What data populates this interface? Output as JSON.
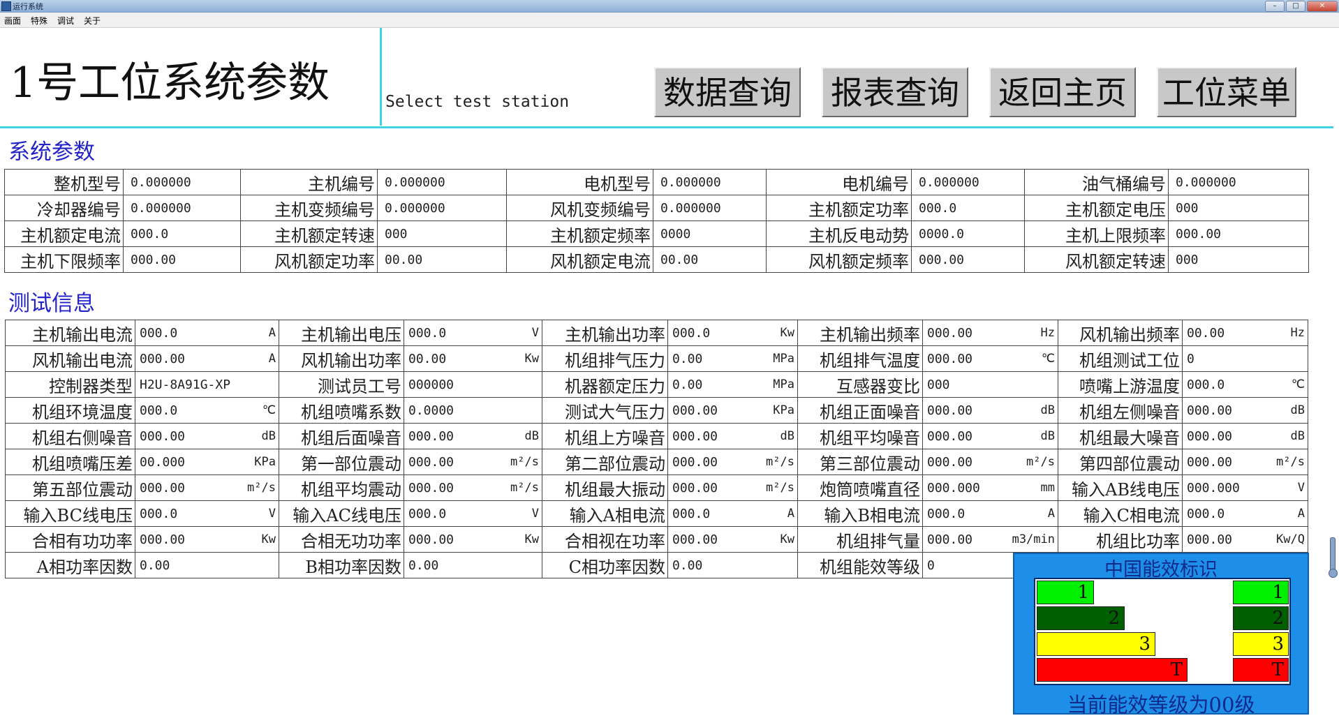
{
  "window": {
    "title": "运行系统",
    "buttons": [
      "–",
      "□",
      "✕"
    ]
  },
  "menu": [
    "画面",
    "特殊",
    "调试",
    "关于"
  ],
  "header": {
    "title": "1号工位系统参数",
    "station_label": "Select test station",
    "buttons": [
      "数据查询",
      "报表查询",
      "返回主页",
      "工位菜单"
    ]
  },
  "system_params": {
    "title": "系统参数",
    "rows": [
      [
        {
          "label": "整机型号",
          "value": "0.000000"
        },
        {
          "label": "主机编号",
          "value": "0.000000"
        },
        {
          "label": "电机型号",
          "value": "0.000000"
        },
        {
          "label": "电机编号",
          "value": "0.000000"
        },
        {
          "label": "油气桶编号",
          "value": "0.000000"
        }
      ],
      [
        {
          "label": "冷却器编号",
          "value": "0.000000"
        },
        {
          "label": "主机变频编号",
          "value": "0.000000"
        },
        {
          "label": "风机变频编号",
          "value": "0.000000"
        },
        {
          "label": "主机额定功率",
          "value": "000.0"
        },
        {
          "label": "主机额定电压",
          "value": "000"
        }
      ],
      [
        {
          "label": "主机额定电流",
          "value": "000.0"
        },
        {
          "label": "主机额定转速",
          "value": "000"
        },
        {
          "label": "主机额定频率",
          "value": "0000"
        },
        {
          "label": "主机反电动势",
          "value": "0000.0"
        },
        {
          "label": "主机上限频率",
          "value": "000.00"
        }
      ],
      [
        {
          "label": "主机下限频率",
          "value": "000.00"
        },
        {
          "label": "风机额定功率",
          "value": "00.00"
        },
        {
          "label": "风机额定电流",
          "value": "00.00"
        },
        {
          "label": "风机额定频率",
          "value": "000.00"
        },
        {
          "label": "风机额定转速",
          "value": "000"
        }
      ]
    ]
  },
  "test_info": {
    "title": "测试信息",
    "rows": [
      [
        {
          "label": "主机输出电流",
          "value": "000.0",
          "unit": "A"
        },
        {
          "label": "主机输出电压",
          "value": "000.0",
          "unit": "V"
        },
        {
          "label": "主机输出功率",
          "value": "000.0",
          "unit": "Kw"
        },
        {
          "label": "主机输出频率",
          "value": "000.00",
          "unit": "Hz"
        },
        {
          "label": "风机输出频率",
          "value": "00.00",
          "unit": "Hz"
        }
      ],
      [
        {
          "label": "风机输出电流",
          "value": "000.00",
          "unit": "A"
        },
        {
          "label": "风机输出功率",
          "value": "00.00",
          "unit": "Kw"
        },
        {
          "label": "机组排气压力",
          "value": "0.00",
          "unit": "MPa"
        },
        {
          "label": "机组排气温度",
          "value": "000.00",
          "unit": "℃"
        },
        {
          "label": "机组测试工位",
          "value": "0",
          "unit": ""
        }
      ],
      [
        {
          "label": "控制器类型",
          "value": "H2U-8A91G-XP",
          "unit": ""
        },
        {
          "label": "测试员工号",
          "value": "000000",
          "unit": ""
        },
        {
          "label": "机器额定压力",
          "value": "0.00",
          "unit": "MPa"
        },
        {
          "label": "互感器变比",
          "value": "000",
          "unit": ""
        },
        {
          "label": "喷嘴上游温度",
          "value": "000.0",
          "unit": "℃"
        }
      ],
      [
        {
          "label": "机组环境温度",
          "value": "000.0",
          "unit": "℃"
        },
        {
          "label": "机组喷嘴系数",
          "value": "0.0000",
          "unit": ""
        },
        {
          "label": "测试大气压力",
          "value": "000.00",
          "unit": "KPa"
        },
        {
          "label": "机组正面噪音",
          "value": "000.00",
          "unit": "dB"
        },
        {
          "label": "机组左侧噪音",
          "value": "000.00",
          "unit": "dB"
        }
      ],
      [
        {
          "label": "机组右侧噪音",
          "value": "000.00",
          "unit": "dB"
        },
        {
          "label": "机组后面噪音",
          "value": "000.00",
          "unit": "dB"
        },
        {
          "label": "机组上方噪音",
          "value": "000.00",
          "unit": "dB"
        },
        {
          "label": "机组平均噪音",
          "value": "000.00",
          "unit": "dB"
        },
        {
          "label": "机组最大噪音",
          "value": "000.00",
          "unit": "dB"
        }
      ],
      [
        {
          "label": "机组喷嘴压差",
          "value": "00.000",
          "unit": "KPa"
        },
        {
          "label": "第一部位震动",
          "value": "000.00",
          "unit": "m²/s"
        },
        {
          "label": "第二部位震动",
          "value": "000.00",
          "unit": "m²/s"
        },
        {
          "label": "第三部位震动",
          "value": "000.00",
          "unit": "m²/s"
        },
        {
          "label": "第四部位震动",
          "value": "000.00",
          "unit": "m²/s"
        }
      ],
      [
        {
          "label": "第五部位震动",
          "value": "000.00",
          "unit": "m²/s"
        },
        {
          "label": "机组平均震动",
          "value": "000.00",
          "unit": "m²/s"
        },
        {
          "label": "机组最大振动",
          "value": "000.00",
          "unit": "m²/s"
        },
        {
          "label": "炮筒喷嘴直径",
          "value": "000.000",
          "unit": "mm"
        },
        {
          "label": "输入AB线电压",
          "value": "000.000",
          "unit": "V"
        }
      ],
      [
        {
          "label": "输入BC线电压",
          "value": "000.0",
          "unit": "V"
        },
        {
          "label": "输入AC线电压",
          "value": "000.0",
          "unit": "V"
        },
        {
          "label": "输入A相电流",
          "value": "000.0",
          "unit": "A"
        },
        {
          "label": "输入B相电流",
          "value": "000.0",
          "unit": "A"
        },
        {
          "label": "输入C相电流",
          "value": "000.0",
          "unit": "A"
        }
      ],
      [
        {
          "label": "合相有功功率",
          "value": "000.00",
          "unit": "Kw"
        },
        {
          "label": "合相无功功率",
          "value": "000.00",
          "unit": "Kw"
        },
        {
          "label": "合相视在功率",
          "value": "000.00",
          "unit": "Kw"
        },
        {
          "label": "机组排气量",
          "value": "000.00",
          "unit": "m3/min"
        },
        {
          "label": "机组比功率",
          "value": "000.00",
          "unit": "Kw/Q"
        }
      ],
      [
        {
          "label": "A相功率因数",
          "value": "0.00",
          "unit": ""
        },
        {
          "label": "B相功率因数",
          "value": "0.00",
          "unit": ""
        },
        {
          "label": "C相功率因数",
          "value": "0.00",
          "unit": ""
        },
        {
          "label": "机组能效等级",
          "value": "0",
          "unit": ""
        }
      ]
    ]
  },
  "efficiency": {
    "title": "中国能效标识",
    "status": "当前能效等级为00级",
    "bars": [
      {
        "label": "1",
        "color": "#00f000"
      },
      {
        "label": "2",
        "color": "#005f00"
      },
      {
        "label": "3",
        "color": "#ffff00"
      },
      {
        "label": "T",
        "color": "#ff0000"
      }
    ],
    "current_labels": [
      "1",
      "2",
      "3",
      "T"
    ]
  }
}
